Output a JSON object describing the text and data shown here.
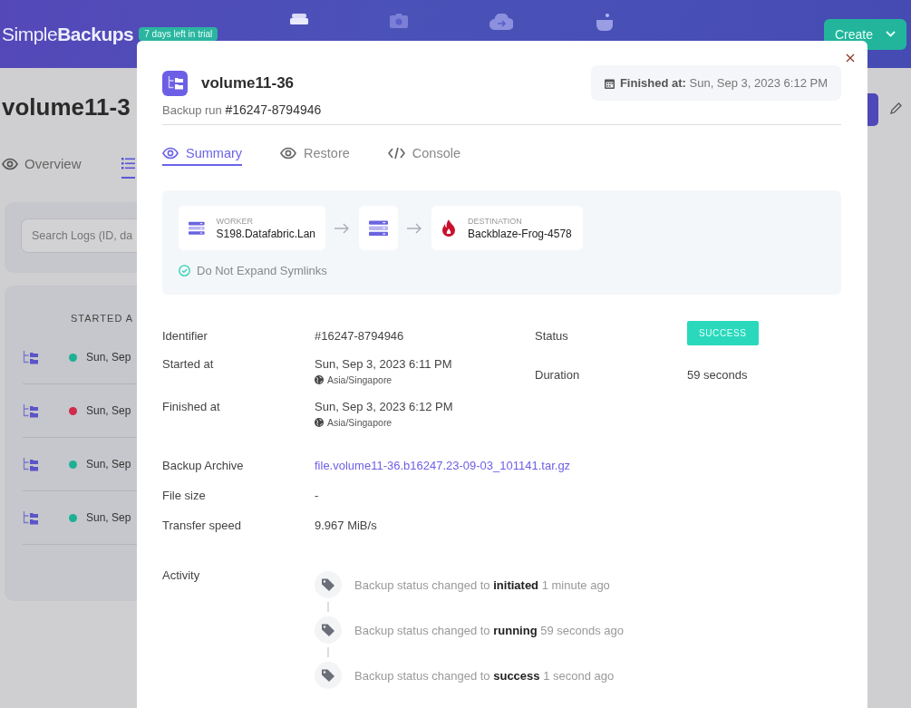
{
  "header": {
    "logo": "Simple**Backups**",
    "trial_badge": "7 days left in trial",
    "create_button": "Create"
  },
  "page": {
    "title": "volume11-3",
    "tabs": [
      {
        "kind": "eye",
        "label": "Overview",
        "selected": false
      },
      {
        "kind": "list",
        "selected": true
      }
    ],
    "search": {
      "placeholder": "Search Logs (ID, da"
    },
    "table": {
      "columns": [
        "STARTED A"
      ],
      "rows": [
        {
          "color": "#1eb095",
          "started_at": "Sun, Sep"
        },
        {
          "color": "#d02a4c",
          "started_at": "Sun, Sep"
        },
        {
          "color": "#1eb095",
          "started_at": "Sun, Sep"
        },
        {
          "color": "#1eb095",
          "started_at": "Sun, Sep"
        }
      ]
    }
  },
  "modal": {
    "title": "volume11-36",
    "finished_label": "Finished at:",
    "finished_value": "Sun, Sep 3, 2023 6:12 PM",
    "run_label": "Backup run",
    "run_id": "#16247-8794946",
    "tabs": [
      {
        "kind": "eye",
        "label": "Summary",
        "selected": true
      },
      {
        "kind": "eye",
        "label": "Restore",
        "selected": false
      },
      {
        "kind": "code",
        "label": "Console",
        "selected": false
      }
    ],
    "flow": {
      "worker": {
        "label": "WORKER",
        "value": "S198.Datafabric.Lan"
      },
      "destination": {
        "label": "DESTINATION",
        "value": "Backblaze-Frog-4578"
      }
    },
    "option": {
      "label": "Do Not Expand Symlinks",
      "checked": true
    },
    "details_left": [
      {
        "label": "Identifier",
        "value": "#16247-8794946"
      },
      {
        "label": "Started at",
        "value": "Sun, Sep 3, 2023 6:11 PM",
        "timezone": "Asia/Singapore"
      },
      {
        "label": "Finished at",
        "value": "Sun, Sep 3, 2023 6:12 PM",
        "timezone": "Asia/Singapore"
      }
    ],
    "details_right": [
      {
        "label": "Status",
        "value": "SUCCESS",
        "kind": "badge"
      },
      {
        "label": "Duration",
        "value": "59 seconds",
        "kind": "text"
      }
    ],
    "details_more": [
      {
        "label": "Backup Archive",
        "value": "file.volume11-36.b16247.23-09-03_101141.tar.gz",
        "kind": "link"
      },
      {
        "label": "File size",
        "value": "-",
        "kind": "text"
      },
      {
        "label": "Transfer speed",
        "value": "9.967 MiB/s",
        "kind": "text"
      }
    ],
    "activity": {
      "label": "Activity",
      "items": [
        "Backup status changed to **initiated** 1 minute ago",
        "Backup status changed to **running** 59 seconds ago",
        "Backup status changed to **success** 1 second ago"
      ]
    }
  }
}
